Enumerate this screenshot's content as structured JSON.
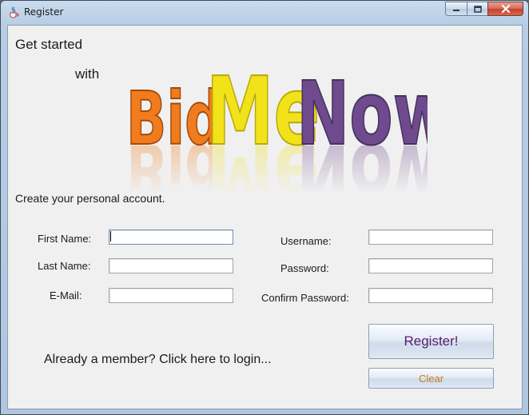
{
  "window": {
    "title": "Register"
  },
  "header": {
    "line1": "Get started",
    "line2": "with",
    "logo_parts": [
      "Bid",
      "Me",
      "Now"
    ],
    "logo_colors": [
      "#f07c1e",
      "#f2e21a",
      "#6f4a8e"
    ]
  },
  "subtitle": "Create your personal account.",
  "form": {
    "first_name_label": "First Name:",
    "first_name_value": "",
    "last_name_label": "Last Name:",
    "last_name_value": "",
    "email_label": "E-Mail:",
    "email_value": "",
    "username_label": "Username:",
    "username_value": "",
    "password_label": "Password:",
    "password_value": "",
    "confirm_label": "Confirm Password:",
    "confirm_value": ""
  },
  "actions": {
    "register_label": "Register!",
    "clear_label": "Clear",
    "login_link": "Already a member? Click here to login..."
  },
  "colors": {
    "register_text": "#5a1a6e",
    "clear_text": "#c8781e"
  }
}
